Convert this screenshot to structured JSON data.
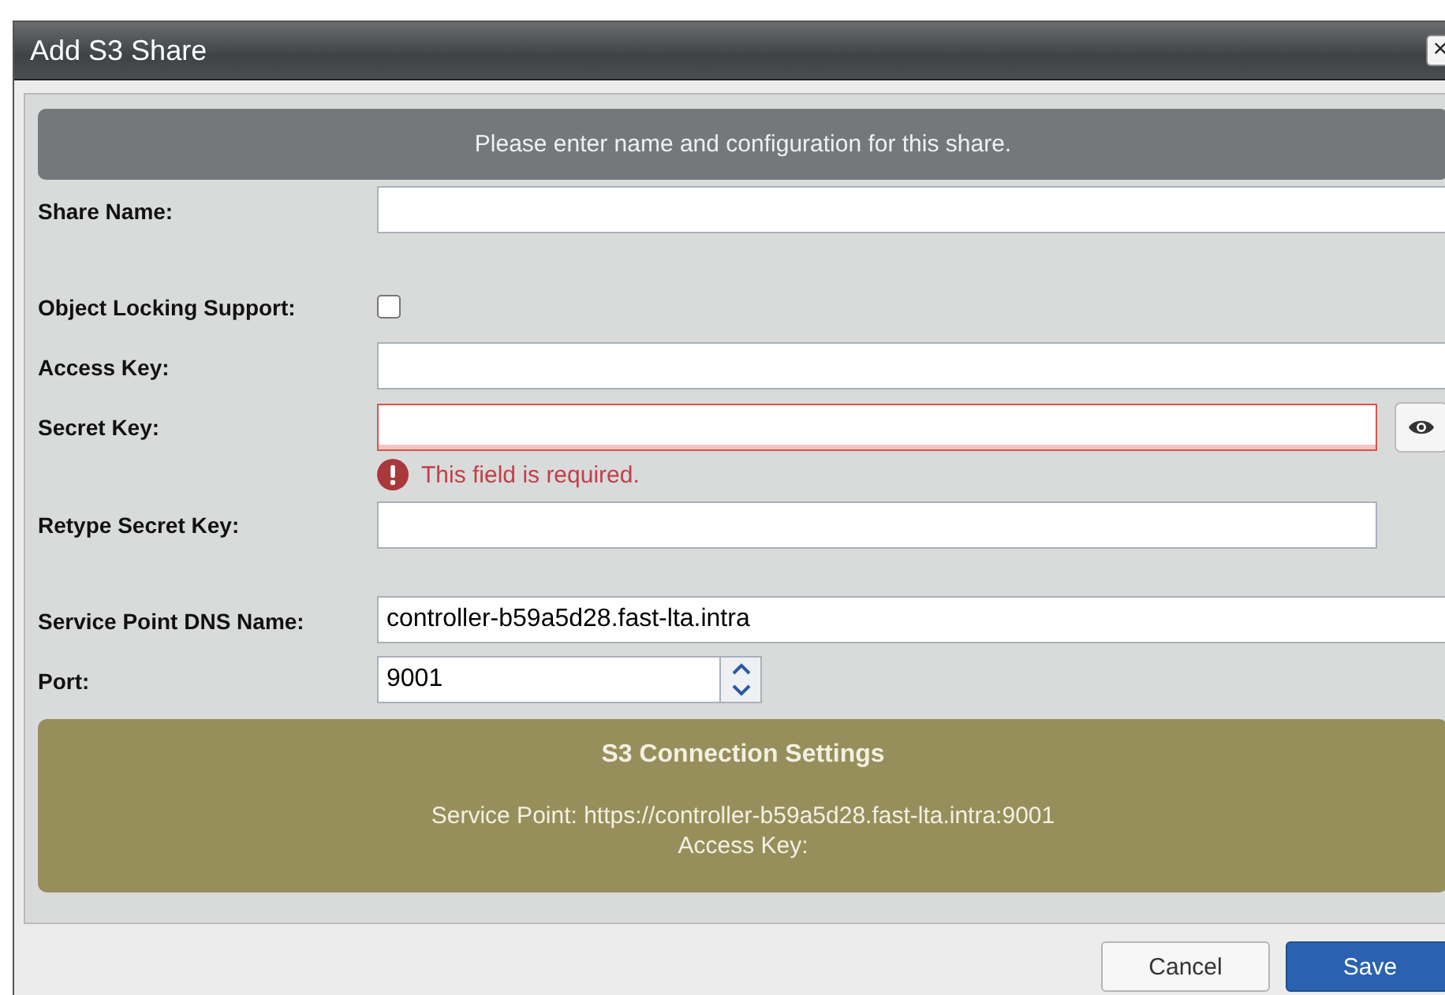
{
  "window": {
    "title": "Add S3 Share",
    "close": "×"
  },
  "banner": "Please enter name and configuration for this share.",
  "field_groups": [
    [
      {
        "kind": "text",
        "label": "Share Name:"
      }
    ],
    [
      {
        "kind": "checkbox",
        "label": "Object Locking Support:",
        "checked": false
      },
      {
        "kind": "text",
        "label": "Access Key:"
      },
      {
        "kind": "secret",
        "label": "Secret Key:",
        "invalid": true,
        "error": "This field is required."
      },
      {
        "kind": "secret-confirm",
        "label": "Retype Secret Key:"
      }
    ],
    [
      {
        "kind": "text",
        "label": "Service Point DNS Name:",
        "value": "controller-b59a5d28.fast-lta.intra"
      },
      {
        "kind": "number",
        "label": "Port:",
        "value": "9001"
      }
    ]
  ],
  "summary": {
    "title": "S3 Connection Settings",
    "lines": [
      "Service Point: https://controller-b59a5d28.fast-lta.intra:9001",
      "Access Key:"
    ]
  },
  "buttons": [
    {
      "label": "Cancel",
      "primary": false
    },
    {
      "label": "Save",
      "primary": true
    }
  ]
}
